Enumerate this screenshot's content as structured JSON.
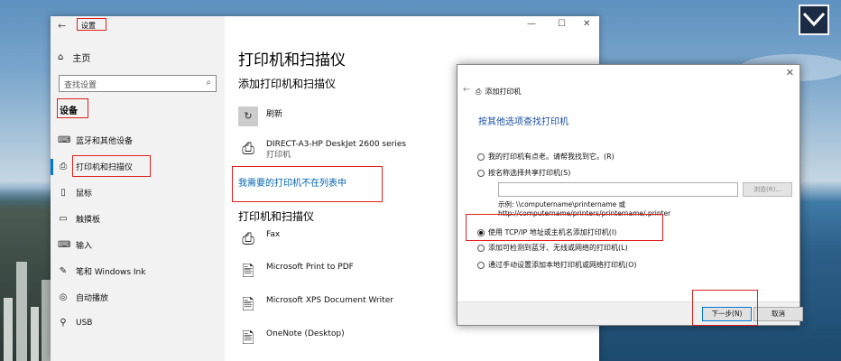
{
  "settings": {
    "title": "设置",
    "home_label": "主页",
    "search_placeholder": "查找设置",
    "section_label": "设备",
    "nav": [
      {
        "label": "蓝牙和其他设备",
        "icon": "bluetooth-devices-icon"
      },
      {
        "label": "打印机和扫描仪",
        "icon": "printer-icon"
      },
      {
        "label": "鼠标",
        "icon": "mouse-icon"
      },
      {
        "label": "触摸板",
        "icon": "touchpad-icon"
      },
      {
        "label": "输入",
        "icon": "keyboard-icon"
      },
      {
        "label": "笔和 Windows Ink",
        "icon": "pen-icon"
      },
      {
        "label": "自动播放",
        "icon": "autoplay-icon"
      },
      {
        "label": "USB",
        "icon": "usb-icon"
      }
    ],
    "selected_nav": "打印机和扫描仪",
    "page_title": "打印机和扫描仪",
    "add_heading": "添加打印机和扫描仪",
    "refresh_label": "刷新",
    "found_printer": {
      "name": "DIRECT-A3-HP DeskJet 2600 series",
      "type": "打印机"
    },
    "not_listed_link": "我需要的打印机不在列表中",
    "list_heading": "打印机和扫描仪",
    "printers": [
      "Fax",
      "Microsoft Print to PDF",
      "Microsoft XPS Document Writer",
      "OneNote (Desktop)"
    ]
  },
  "dialog": {
    "title": "添加打印机",
    "heading": "按其他选项查找打印机",
    "options": [
      {
        "label": "我的打印机有点老。请帮我找到它。(R)",
        "selected": false
      },
      {
        "label": "按名称选择共享打印机(S)",
        "selected": false
      },
      {
        "label": "使用 TCP/IP 地址或主机名添加打印机(I)",
        "selected": true
      },
      {
        "label": "添加可检测到蓝牙、无线或网络的打印机(L)",
        "selected": false
      },
      {
        "label": "通过手动设置添加本地打印机或网络打印机(O)",
        "selected": false
      }
    ],
    "browse_label": "浏览(R)...",
    "example_line1": "示例: \\\\computername\\printername 或",
    "example_line2": "http://computername/printers/printername/.printer",
    "next_label": "下一步(N)",
    "cancel_label": "取消"
  },
  "colors": {
    "accent": "#0078d7",
    "link": "#0063b1",
    "highlight_box": "#e0201d"
  }
}
